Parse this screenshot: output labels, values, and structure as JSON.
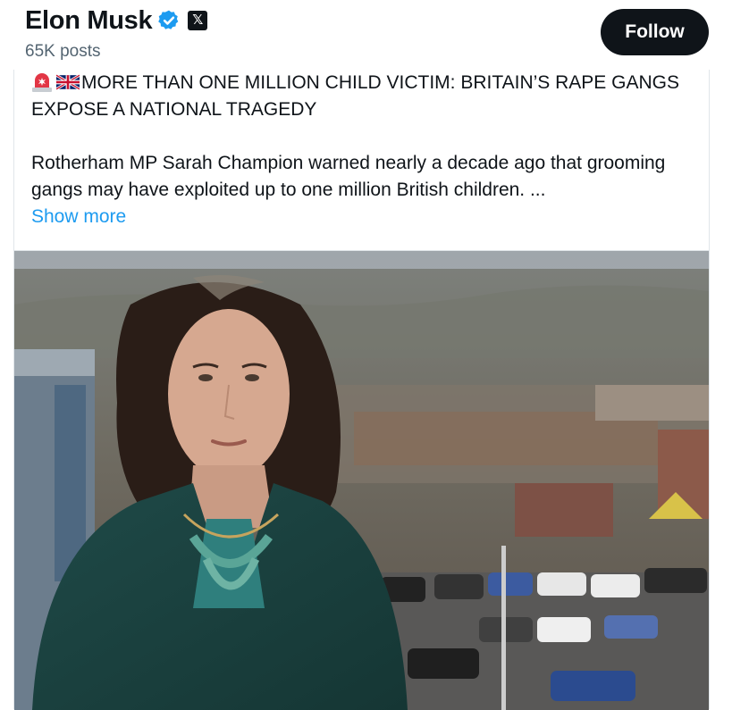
{
  "profile": {
    "name": "Elon Musk",
    "posts": "65K posts",
    "verified_icon": "verified-badge-icon",
    "affiliation_icon": "x-logo-icon"
  },
  "actions": {
    "follow_label": "Follow"
  },
  "post": {
    "headline_emojis": [
      "police-siren-icon",
      "uk-flag-icon"
    ],
    "headline": "MORE THAN ONE MILLION CHILD VICTIM: BRITAIN’S RAPE GANGS EXPOSE A NATIONAL TRAGEDY",
    "body": "Rotherham MP Sarah Champion warned nearly a decade ago that grooming gangs may have exploited up to one million British children. ...",
    "show_more": "Show more"
  },
  "colors": {
    "link": "#1d9bf0",
    "button": "#0f1419",
    "muted": "#536471",
    "verified": "#1d9bf0"
  }
}
